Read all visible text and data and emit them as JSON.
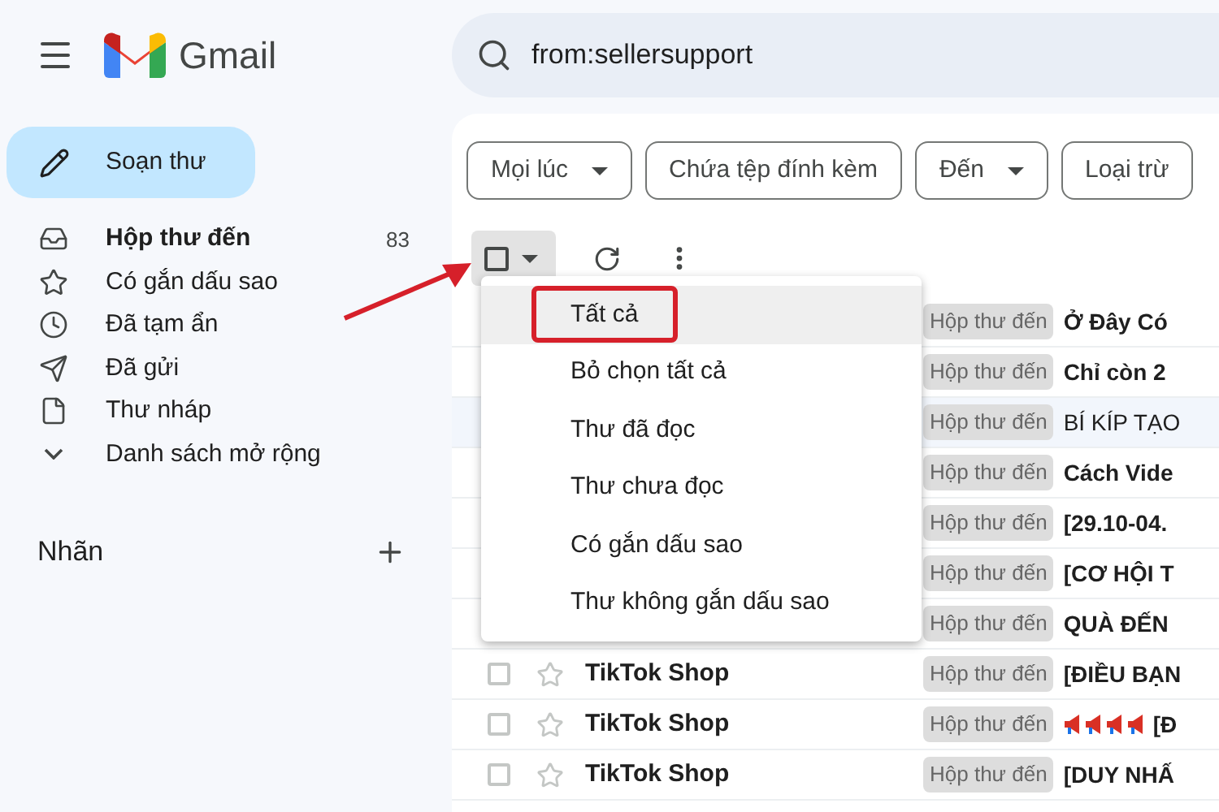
{
  "app": {
    "name": "Gmail"
  },
  "search": {
    "value": "from:sellersupport"
  },
  "compose": {
    "label": "Soạn thư"
  },
  "sidebar": {
    "items": [
      {
        "kind": "inbox",
        "label": "Hộp thư đến",
        "count": "83",
        "selected": true
      },
      {
        "kind": "starred",
        "label": "Có gắn dấu sao",
        "selected": false
      },
      {
        "kind": "snoozed",
        "label": "Đã tạm ẩn",
        "selected": false
      },
      {
        "kind": "sent",
        "label": "Đã gửi",
        "selected": false
      },
      {
        "kind": "drafts",
        "label": "Thư nháp",
        "selected": false
      },
      {
        "kind": "more",
        "label": "Danh sách mở rộng",
        "selected": false
      }
    ]
  },
  "labels_section": {
    "title": "Nhãn"
  },
  "filters": [
    {
      "label": "Mọi lúc",
      "dropdown": true
    },
    {
      "label": "Chứa tệp đính kèm",
      "dropdown": false
    },
    {
      "label": "Đến",
      "dropdown": true
    },
    {
      "label": "Loại trừ",
      "dropdown": false
    }
  ],
  "select_all": {
    "checked": false
  },
  "select_menu": {
    "items": [
      {
        "label": "Tất cả",
        "highlighted": true
      },
      {
        "label": "Bỏ chọn tất cả",
        "highlighted": false
      },
      {
        "label": "Thư đã đọc",
        "highlighted": false
      },
      {
        "label": "Thư chưa đọc",
        "highlighted": false
      },
      {
        "label": "Có gắn dấu sao",
        "highlighted": false
      },
      {
        "label": "Thư không gắn dấu sao",
        "highlighted": false
      }
    ]
  },
  "messages": [
    {
      "label": "Hộp thư đến",
      "subject": "Ở Đây Có",
      "unread": true
    },
    {
      "label": "Hộp thư đến",
      "subject": "Chỉ còn 2",
      "unread": true
    },
    {
      "label": "Hộp thư đến",
      "subject": "BÍ KÍP TẠO",
      "unread": false
    },
    {
      "label": "Hộp thư đến",
      "subject": "Cách Vide",
      "unread": true
    },
    {
      "label": "Hộp thư đến",
      "subject": "[29.10-04.",
      "unread": true
    },
    {
      "label": "Hộp thư đến",
      "subject": "[CƠ HỘI T",
      "unread": true
    },
    {
      "label": "Hộp thư đến",
      "subject": "QUÀ ĐẾN",
      "unread": true
    },
    {
      "sender": "TikTok Shop",
      "checked": false,
      "starred": false,
      "label": "Hộp thư đến",
      "subject": "[ĐIỀU BẠN",
      "unread": true
    },
    {
      "sender": "TikTok Shop",
      "checked": false,
      "starred": false,
      "label": "Hộp thư đến",
      "kind": "promo",
      "subject": "[Đ",
      "unread": true
    },
    {
      "sender": "TikTok Shop",
      "checked": false,
      "starred": false,
      "label": "Hộp thư đến",
      "subject": "[DUY NHẤ",
      "unread": true
    }
  ]
}
